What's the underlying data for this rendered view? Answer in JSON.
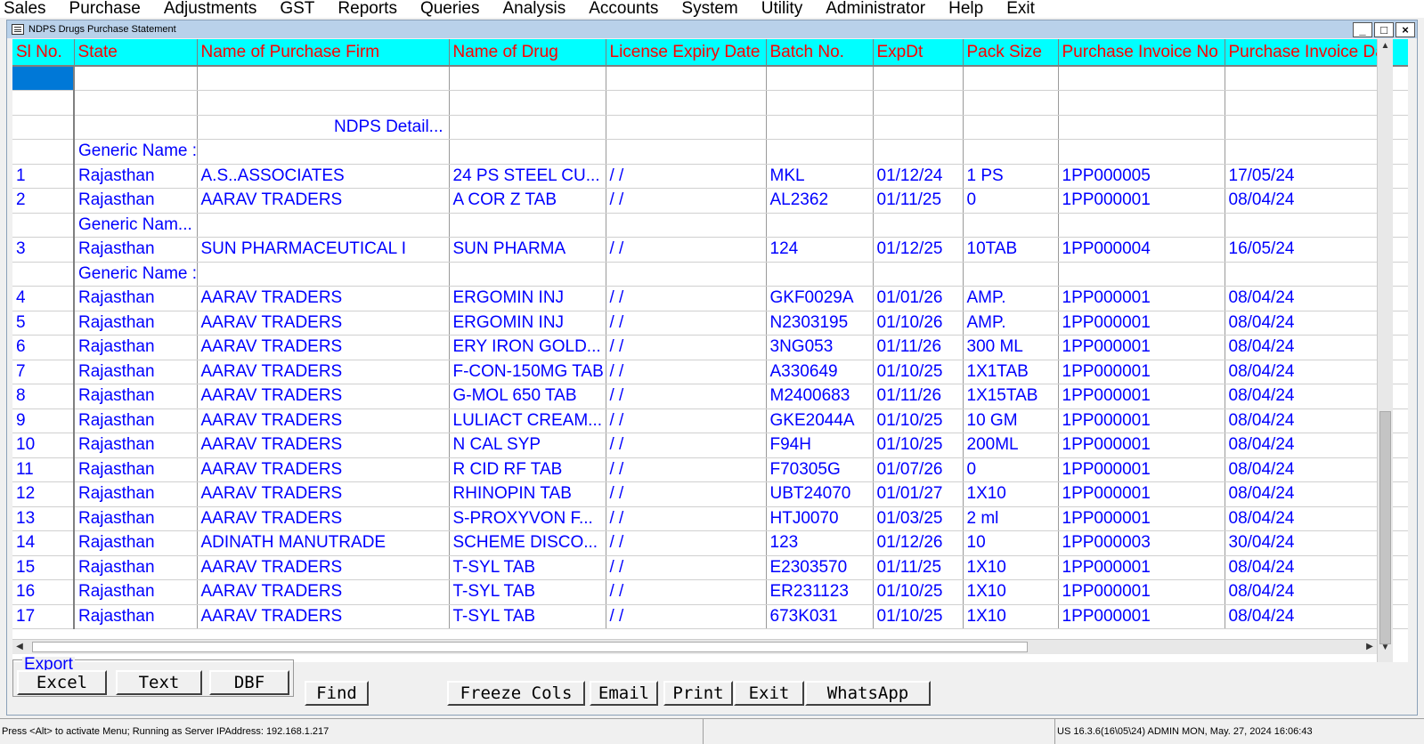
{
  "menu": [
    {
      "label": "Sales"
    },
    {
      "label": "Purchase"
    },
    {
      "label": "Adjustments"
    },
    {
      "label": "GST"
    },
    {
      "label": "Reports"
    },
    {
      "label": "Queries"
    },
    {
      "label": "Analysis"
    },
    {
      "label": "Accounts"
    },
    {
      "label": "System"
    },
    {
      "label": "Utility"
    },
    {
      "label": "Administrator"
    },
    {
      "label": "Help"
    },
    {
      "label": "Exit"
    }
  ],
  "window": {
    "title": "NDPS Drugs Purchase Statement",
    "minimize": "_",
    "maximize": "□",
    "close": "×"
  },
  "grid": {
    "headers": [
      "Sl No.",
      "State",
      "Name of  Purchase Firm",
      "Name of Drug",
      "License Expiry Date",
      "Batch No.",
      "ExpDt",
      "Pack Size",
      "Purchase Invoice No",
      "Purchase Invoice Da"
    ],
    "rows": [
      {
        "cells": [
          "",
          "",
          "",
          "",
          "",
          "",
          "",
          "",
          "",
          ""
        ],
        "selected": true
      },
      {
        "cells": [
          "",
          "",
          "",
          "",
          "",
          "",
          "",
          "",
          "",
          ""
        ]
      },
      {
        "cells": [
          "",
          "",
          "NDPS Detail...",
          "",
          "",
          "",
          "",
          "",
          "",
          ""
        ],
        "right_col": 2
      },
      {
        "cells": [
          "",
          "Generic Name :",
          "",
          "",
          "",
          "",
          "",
          "",
          "",
          ""
        ]
      },
      {
        "cells": [
          "1",
          "Rajasthan",
          "A.S..ASSOCIATES",
          "24 PS STEEL CU...",
          " /  /",
          "MKL",
          "01/12/24",
          "1 PS",
          "1PP000005",
          "17/05/24"
        ]
      },
      {
        "cells": [
          "2",
          "Rajasthan",
          "AARAV TRADERS",
          "A COR Z TAB",
          " /  /",
          "AL2362",
          "01/11/25",
          "0",
          "1PP000001",
          "08/04/24"
        ]
      },
      {
        "cells": [
          "",
          "Generic Nam...",
          "",
          "",
          "",
          "",
          "",
          "",
          "",
          ""
        ]
      },
      {
        "cells": [
          "3",
          "Rajasthan",
          "SUN PHARMACEUTICAL I",
          "SUN PHARMA",
          " /  /",
          "124",
          "01/12/25",
          "10TAB",
          "1PP000004",
          "16/05/24"
        ]
      },
      {
        "cells": [
          "",
          "Generic Name :",
          "",
          "",
          "",
          "",
          "",
          "",
          "",
          ""
        ]
      },
      {
        "cells": [
          "4",
          "Rajasthan",
          "AARAV TRADERS",
          "ERGOMIN INJ",
          " /  /",
          "GKF0029A",
          "01/01/26",
          "AMP.",
          "1PP000001",
          "08/04/24"
        ]
      },
      {
        "cells": [
          "5",
          "Rajasthan",
          "AARAV TRADERS",
          "ERGOMIN INJ",
          " /  /",
          "N2303195",
          "01/10/26",
          "AMP.",
          "1PP000001",
          "08/04/24"
        ]
      },
      {
        "cells": [
          "6",
          "Rajasthan",
          "AARAV TRADERS",
          "ERY IRON GOLD...",
          " /  /",
          "3NG053",
          "01/11/26",
          "300 ML",
          "1PP000001",
          "08/04/24"
        ]
      },
      {
        "cells": [
          "7",
          "Rajasthan",
          "AARAV TRADERS",
          "F-CON-150MG TAB",
          " /  /",
          "A330649",
          "01/10/25",
          "1X1TAB",
          "1PP000001",
          "08/04/24"
        ]
      },
      {
        "cells": [
          "8",
          "Rajasthan",
          "AARAV TRADERS",
          "G-MOL 650 TAB",
          " /  /",
          "M2400683",
          "01/11/26",
          "1X15TAB",
          "1PP000001",
          "08/04/24"
        ]
      },
      {
        "cells": [
          "9",
          "Rajasthan",
          "AARAV TRADERS",
          "LULIACT CREAM...",
          " /  /",
          "GKE2044A",
          "01/10/25",
          "10 GM",
          "1PP000001",
          "08/04/24"
        ]
      },
      {
        "cells": [
          "10",
          "Rajasthan",
          "AARAV TRADERS",
          "N CAL SYP",
          " /  /",
          "F94H",
          "01/10/25",
          "200ML",
          "1PP000001",
          "08/04/24"
        ]
      },
      {
        "cells": [
          "11",
          "Rajasthan",
          "AARAV TRADERS",
          "R CID RF TAB",
          " /  /",
          "F70305G",
          "01/07/26",
          "0",
          "1PP000001",
          "08/04/24"
        ]
      },
      {
        "cells": [
          "12",
          "Rajasthan",
          "AARAV TRADERS",
          "RHINOPIN TAB",
          " /  /",
          "UBT24070",
          "01/01/27",
          "1X10",
          "1PP000001",
          "08/04/24"
        ]
      },
      {
        "cells": [
          "13",
          "Rajasthan",
          "AARAV TRADERS",
          "S-PROXYVON F...",
          " /  /",
          "HTJ0070",
          "01/03/25",
          "2 ml",
          "1PP000001",
          "08/04/24"
        ]
      },
      {
        "cells": [
          "14",
          "Rajasthan",
          "ADINATH MANUTRADE",
          "SCHEME DISCO...",
          " /  /",
          "123",
          "01/12/26",
          "10",
          "1PP000003",
          "30/04/24"
        ]
      },
      {
        "cells": [
          "15",
          "Rajasthan",
          "AARAV TRADERS",
          "T-SYL TAB",
          " /  /",
          "E2303570",
          "01/11/25",
          "1X10",
          "1PP000001",
          "08/04/24"
        ]
      },
      {
        "cells": [
          "16",
          "Rajasthan",
          "AARAV TRADERS",
          "T-SYL TAB",
          " /  /",
          "ER231123",
          "01/10/25",
          "1X10",
          "1PP000001",
          "08/04/24"
        ]
      },
      {
        "cells": [
          "17",
          "Rajasthan",
          "AARAV TRADERS",
          "T-SYL TAB",
          " /  /",
          "673K031",
          "01/10/25",
          "1X10",
          "1PP000001",
          "08/04/24"
        ]
      }
    ]
  },
  "export": {
    "legend": "Export",
    "excel": "Excel",
    "text": "Text",
    "dbf": "DBF"
  },
  "buttons": {
    "find": "Find",
    "freeze": "Freeze Cols",
    "email": "Email",
    "print": "Print",
    "exit": "Exit",
    "whatsapp": "WhatsApp"
  },
  "status": {
    "left": "Press <Alt> to activate Menu; Running as Server IPAddress: 192.168.1.217",
    "right": "US 16.3.6(16\\05\\24) ADMIN  MON, May. 27, 2024  16:06:43"
  },
  "colors": {
    "header_bg": "#00ffff",
    "header_text": "#ff0000",
    "cell_text": "#0000ff",
    "selection": "#0078d7"
  }
}
